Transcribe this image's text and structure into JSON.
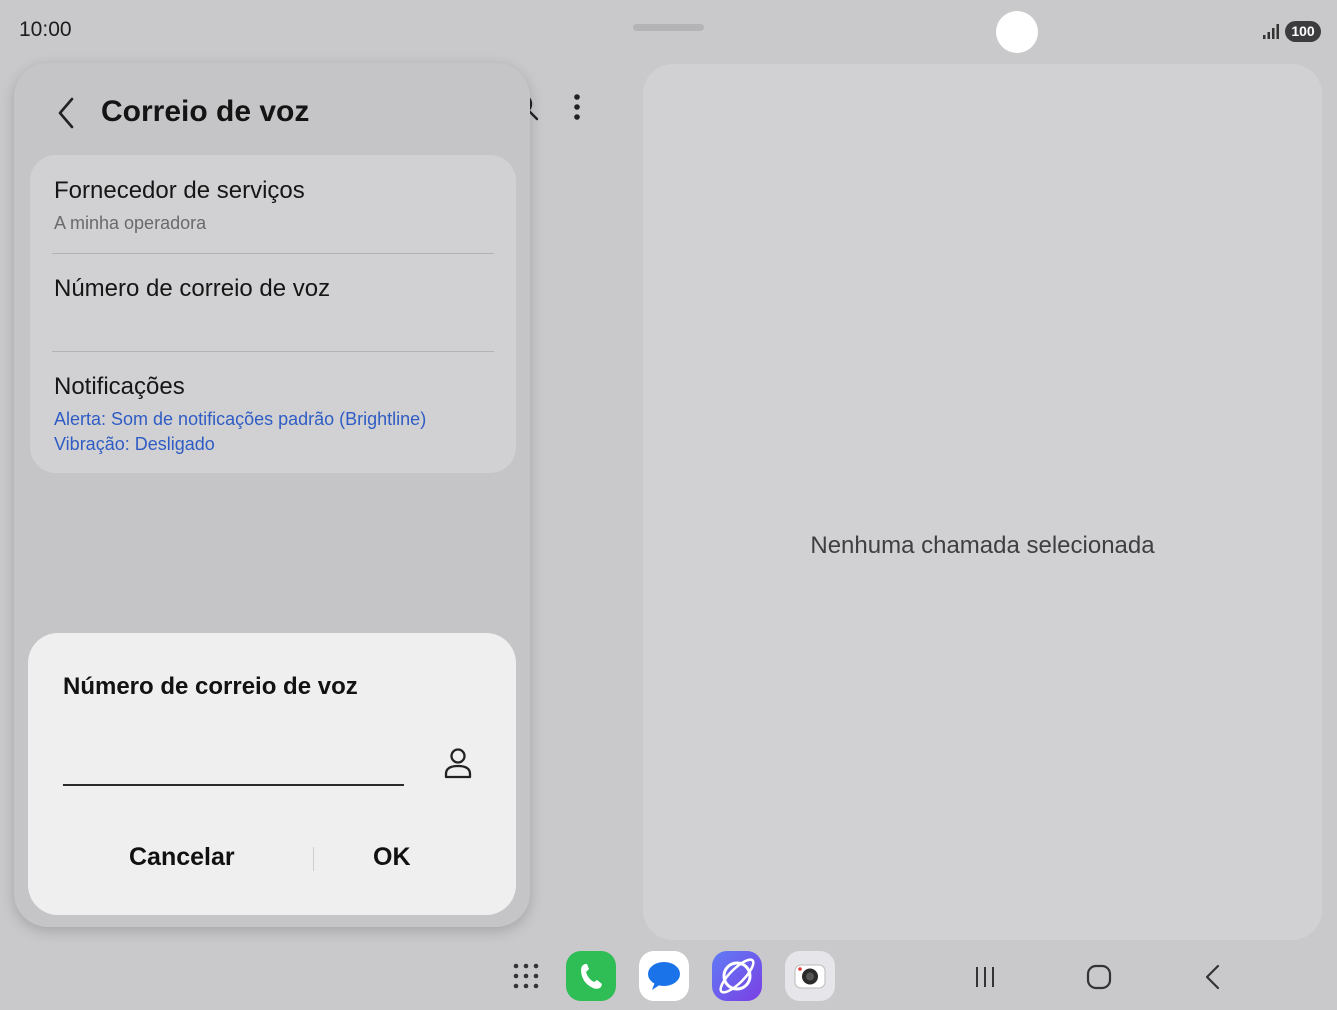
{
  "status_bar": {
    "time": "10:00",
    "battery": "100"
  },
  "header": {
    "title": "Correio de voz"
  },
  "settings": [
    {
      "title": "Fornecedor de serviços",
      "subtitle_lines": [
        "A minha operadora"
      ]
    },
    {
      "title": "Número de correio de voz",
      "subtitle_lines": []
    },
    {
      "title": "Notificações",
      "subtitle_lines": [
        "Alerta: Som de notificações padrão (Brightline)",
        "Vibração: Desligado"
      ]
    }
  ],
  "dialog": {
    "title": "Número de correio de voz",
    "input_value": "",
    "cancel_label": "Cancelar",
    "ok_label": "OK"
  },
  "detail_pane": {
    "empty_message": "Nenhuma chamada selecionada"
  },
  "dock": {
    "apps": [
      {
        "icon": "phone-icon",
        "color": "#2fbd55"
      },
      {
        "icon": "messages-icon",
        "color": "#1a73e8"
      },
      {
        "icon": "internet-icon",
        "color": "#6a55ee"
      },
      {
        "icon": "camera-icon",
        "color": "#e6e6ea"
      }
    ]
  },
  "colors": {
    "accent_blue": "#2f5cc4",
    "background": "#c9c9cb",
    "card": "#d1d1d3",
    "dialog": "#efefef"
  }
}
